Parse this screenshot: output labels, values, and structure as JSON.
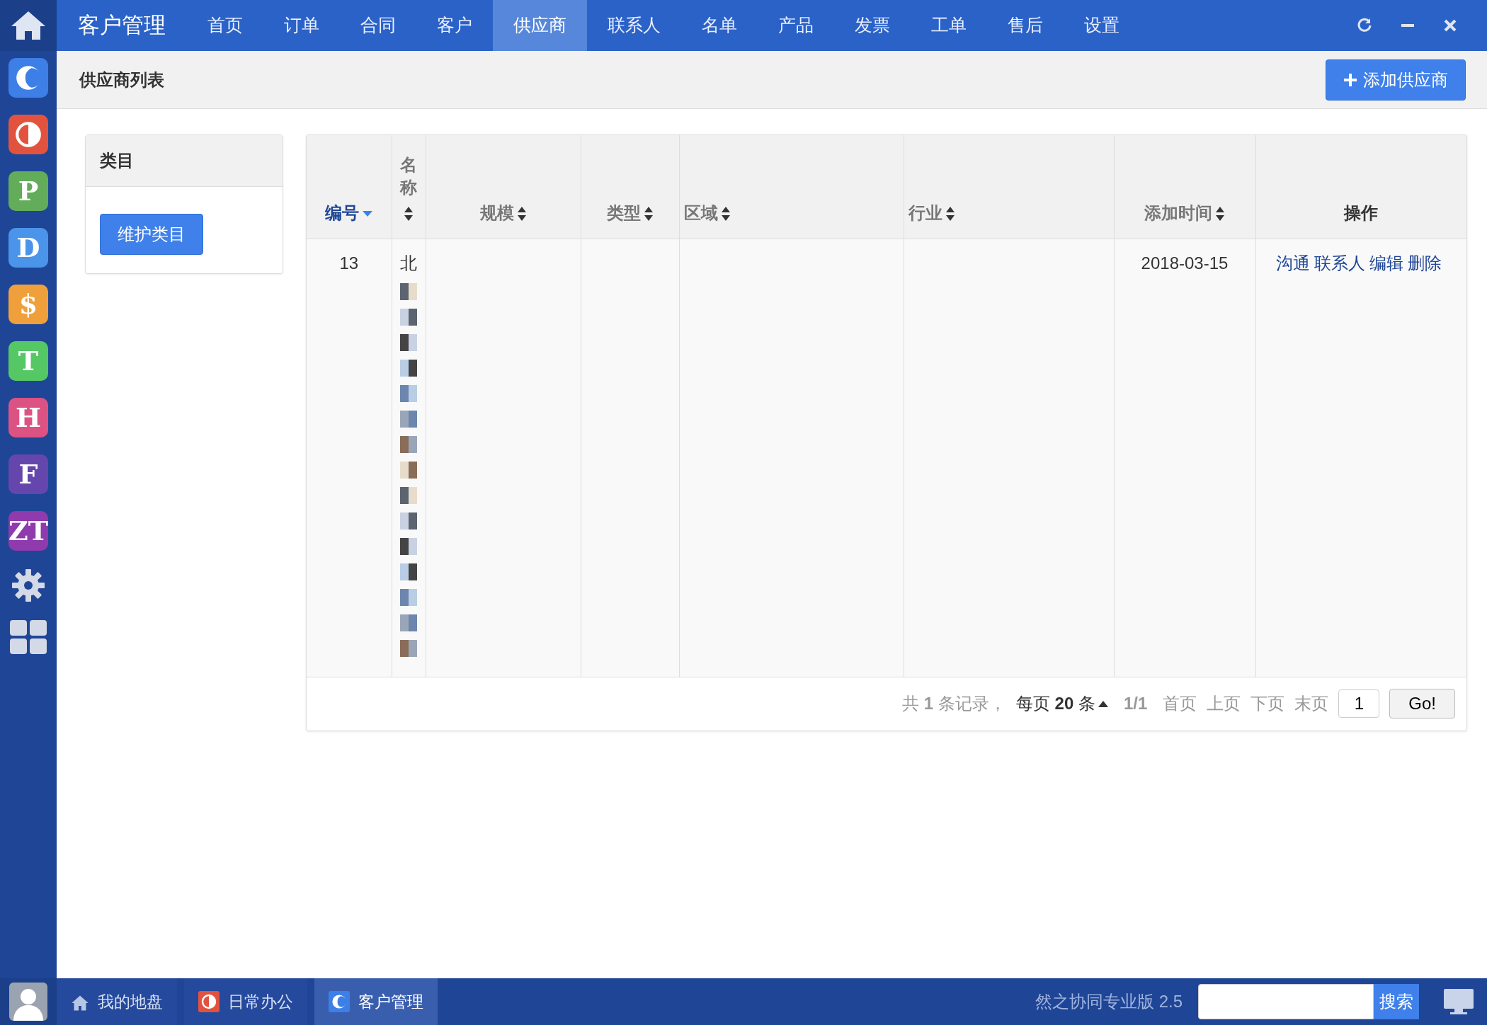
{
  "app_bar": {
    "title": "客户管理",
    "nav": [
      {
        "label": "首页",
        "selected": false
      },
      {
        "label": "订单",
        "selected": false
      },
      {
        "label": "合同",
        "selected": false
      },
      {
        "label": "客户",
        "selected": false
      },
      {
        "label": "供应商",
        "selected": true
      },
      {
        "label": "联系人",
        "selected": false
      },
      {
        "label": "名单",
        "selected": false
      },
      {
        "label": "产品",
        "selected": false
      },
      {
        "label": "发票",
        "selected": false
      },
      {
        "label": "工单",
        "selected": false
      },
      {
        "label": "售后",
        "selected": false
      },
      {
        "label": "设置",
        "selected": false
      }
    ]
  },
  "sidebar": {
    "items": [
      {
        "kind": "crescent",
        "color": "#3d7fe6"
      },
      {
        "kind": "half",
        "color": "#e2533f"
      },
      {
        "kind": "letter",
        "text": "P",
        "color": "#63ac5a"
      },
      {
        "kind": "letter",
        "text": "D",
        "color": "#4a95ea"
      },
      {
        "kind": "letter",
        "text": "$",
        "color": "#f0a03a"
      },
      {
        "kind": "letter",
        "text": "T",
        "color": "#55c865"
      },
      {
        "kind": "letter",
        "text": "H",
        "color": "#dc5383"
      },
      {
        "kind": "letter",
        "text": "F",
        "color": "#6546ad"
      },
      {
        "kind": "letter",
        "text": "ZT",
        "color": "#8f3bad"
      },
      {
        "kind": "gear"
      },
      {
        "kind": "grid"
      }
    ]
  },
  "page_header": {
    "title": "供应商列表",
    "add_button": "添加供应商"
  },
  "category_panel": {
    "title": "类目",
    "button": "维护类目"
  },
  "table": {
    "columns": [
      {
        "label": "编号",
        "sortable": true,
        "sorted": true
      },
      {
        "label": "名称",
        "sortable": true,
        "sorted": false
      },
      {
        "label": "规模",
        "sortable": true,
        "sorted": false
      },
      {
        "label": "类型",
        "sortable": true,
        "sorted": false
      },
      {
        "label": "区域",
        "sortable": true,
        "sorted": false
      },
      {
        "label": "行业",
        "sortable": true,
        "sorted": false
      },
      {
        "label": "添加时间",
        "sortable": true,
        "sorted": false
      },
      {
        "label": "操作",
        "sortable": false,
        "sorted": false
      }
    ],
    "rows": [
      {
        "id": "13",
        "name": "北",
        "name_redacted": true,
        "added": "2018-03-15",
        "actions": [
          "沟通",
          "联系人",
          "编辑",
          "删除"
        ]
      }
    ]
  },
  "pager": {
    "summary": "共 **1** 条记录，",
    "per_page": "每页 **20** 条",
    "pages": "1/1",
    "links": [
      "首页",
      "上页",
      "下页",
      "末页"
    ],
    "page_input": "1",
    "go": "Go!"
  },
  "taskbar": {
    "items": [
      {
        "kind": "home",
        "label": "我的地盘",
        "selected": false
      },
      {
        "kind": "half",
        "label": "日常办公",
        "color": "#e2533f",
        "selected": false
      },
      {
        "kind": "crescent",
        "label": "客户管理",
        "color": "#3d7fe6",
        "selected": true
      }
    ],
    "version": "然之协同专业版 2.5",
    "search_button": "搜索"
  }
}
